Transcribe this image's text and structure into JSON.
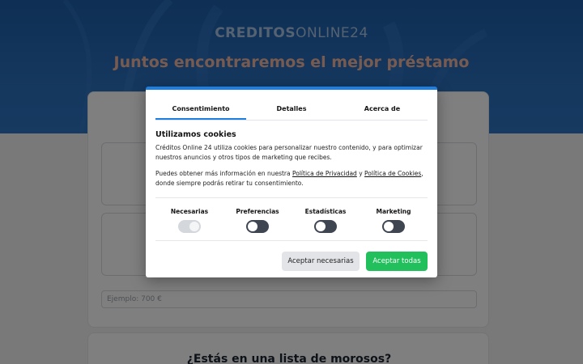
{
  "header": {
    "logo_bold": "CREDITOS",
    "logo_light": "ONLINE",
    "logo_num": "24",
    "headline": "Juntos encontraremos el mejor préstamo"
  },
  "form": {
    "amount_placeholder": "Ejemplo: 700 €"
  },
  "section2": {
    "title": "¿Estás en una lista de morosos?"
  },
  "cookie_modal": {
    "tabs": [
      "Consentimiento",
      "Detalles",
      "Acerca de"
    ],
    "active_tab": "Consentimiento",
    "title": "Utilizamos cookies",
    "paragraph1": "Créditos Online 24 utiliza cookies para personalizar nuestro contenido, y para optimizar nuestros anuncios y otros tipos de marketing que recibes.",
    "p2_before": "Puedes obtener más información en nuestra ",
    "privacy_link": "Política de Privacidad",
    "p2_and": " y ",
    "cookies_link": "Política de Cookies",
    "p2_after": ", donde siempre podrás retirar tu consentimiento.",
    "categories": [
      {
        "label": "Necesarias",
        "state": "on",
        "disabled": true
      },
      {
        "label": "Preferencias",
        "state": "off"
      },
      {
        "label": "Estadísticas",
        "state": "off"
      },
      {
        "label": "Marketing",
        "state": "off"
      }
    ],
    "btn_necessary": "Aceptar necesarias",
    "btn_all": "Aceptar todas"
  },
  "colors": {
    "accent": "#1f7fe0",
    "accept_green": "#21c05d",
    "hero_blue": "#2a6fbd"
  }
}
